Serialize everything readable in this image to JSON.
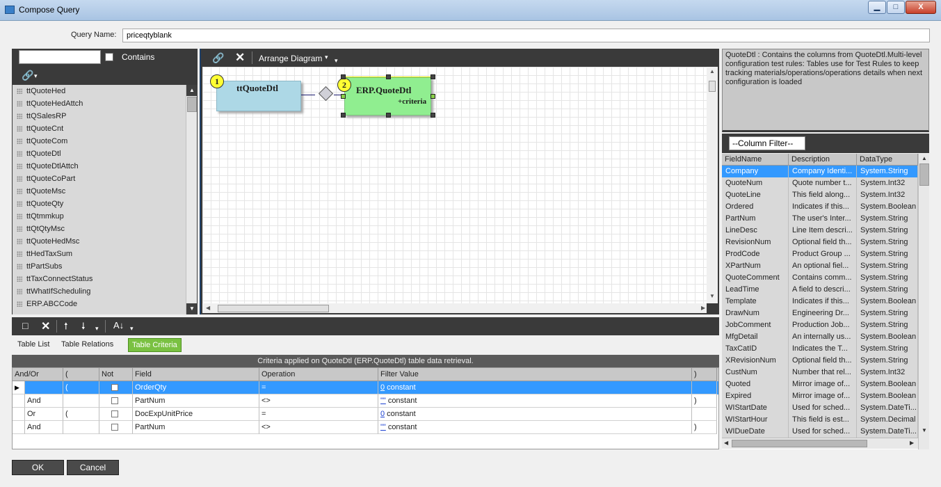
{
  "window": {
    "title": "Compose Query",
    "min_label": "▁",
    "max_label": "□",
    "close_label": "X"
  },
  "query": {
    "label": "Query Name:",
    "value": "priceqtyblank"
  },
  "table_search": {
    "value": "",
    "contains_label": "Contains"
  },
  "tables": [
    "ttQuoteHed",
    "ttQuoteHedAttch",
    "ttQSalesRP",
    "ttQuoteCnt",
    "ttQuoteCom",
    "ttQuoteDtl",
    "ttQuoteDtlAttch",
    "ttQuoteCoPart",
    "ttQuoteMsc",
    "ttQuoteQty",
    "ttQtmmkup",
    "ttQtQtyMsc",
    "ttQuoteHedMsc",
    "ttHedTaxSum",
    "ttPartSubs",
    "ttTaxConnectStatus",
    "ttWhatIfScheduling",
    "ERP.ABCCode"
  ],
  "diagram": {
    "arrange_label": "Arrange Diagram",
    "node1": {
      "badge": "1",
      "title": "ttQuoteDtl"
    },
    "node2": {
      "badge": "2",
      "title": "ERP.QuoteDtl",
      "subtitle": "+criteria"
    }
  },
  "description": "QuoteDtl : Contains the columns from QuoteDtl.Multi-level configuration test rules: Tables use for Test Rules to keep tracking materials/operations/operations details when next configuration is loaded",
  "column_filter": {
    "value": "--Column Filter--"
  },
  "columns_header": {
    "field": "FieldName",
    "desc": "Description",
    "type": "DataType"
  },
  "columns": [
    {
      "field": "Company",
      "desc": "Company Identi...",
      "type": "System.String"
    },
    {
      "field": "QuoteNum",
      "desc": "Quote number t...",
      "type": "System.Int32"
    },
    {
      "field": "QuoteLine",
      "desc": "This field along...",
      "type": "System.Int32"
    },
    {
      "field": "Ordered",
      "desc": "Indicates if this...",
      "type": "System.Boolean"
    },
    {
      "field": "PartNum",
      "desc": "The user's Inter...",
      "type": "System.String"
    },
    {
      "field": "LineDesc",
      "desc": "Line Item descri...",
      "type": "System.String"
    },
    {
      "field": "RevisionNum",
      "desc": "Optional field th...",
      "type": "System.String"
    },
    {
      "field": "ProdCode",
      "desc": "Product Group ...",
      "type": "System.String"
    },
    {
      "field": "XPartNum",
      "desc": "An optional fiel...",
      "type": "System.String"
    },
    {
      "field": "QuoteComment",
      "desc": "Contains comm...",
      "type": "System.String"
    },
    {
      "field": "LeadTime",
      "desc": "A field to descri...",
      "type": "System.String"
    },
    {
      "field": "Template",
      "desc": "Indicates if this...",
      "type": "System.Boolean"
    },
    {
      "field": "DrawNum",
      "desc": "Engineering Dr...",
      "type": "System.String"
    },
    {
      "field": "JobComment",
      "desc": "Production Job...",
      "type": "System.String"
    },
    {
      "field": "MfgDetail",
      "desc": "An internally us...",
      "type": "System.Boolean"
    },
    {
      "field": "TaxCatID",
      "desc": "Indicates the T...",
      "type": "System.String"
    },
    {
      "field": "XRevisionNum",
      "desc": "Optional field th...",
      "type": "System.String"
    },
    {
      "field": "CustNum",
      "desc": "Number that rel...",
      "type": "System.Int32"
    },
    {
      "field": "Quoted",
      "desc": "Mirror image of...",
      "type": "System.Boolean"
    },
    {
      "field": "Expired",
      "desc": "Mirror image of...",
      "type": "System.Boolean"
    },
    {
      "field": "WIStartDate",
      "desc": "Used for sched...",
      "type": "System.DateTi..."
    },
    {
      "field": "WIStartHour",
      "desc": "This field is est...",
      "type": "System.Decimal"
    },
    {
      "field": "WIDueDate",
      "desc": "Used for sched...",
      "type": "System.DateTi..."
    }
  ],
  "tabs": [
    "Table List",
    "Table Relations",
    "Table Criteria"
  ],
  "criteria": {
    "caption": "Criteria applied on QuoteDtl (ERP.QuoteDtl)  table data retrieval.",
    "headers": [
      "And/Or",
      "(",
      "Not",
      "Field",
      "Operation",
      "Filter Value",
      ")"
    ],
    "rows": [
      {
        "andor": "",
        "paren_open": "(",
        "field": "OrderQty",
        "op": "=",
        "fv_num": "0",
        "fv_text": "constant",
        "paren_close": ""
      },
      {
        "andor": "And",
        "paren_open": "",
        "field": "PartNum",
        "op": "<>",
        "fv_num": "\"\"",
        "fv_text": "constant",
        "paren_close": ")"
      },
      {
        "andor": "Or",
        "paren_open": "(",
        "field": "DocExpUnitPrice",
        "op": "=",
        "fv_num": "0",
        "fv_text": "constant",
        "paren_close": ""
      },
      {
        "andor": "And",
        "paren_open": "",
        "field": "PartNum",
        "op": "<>",
        "fv_num": "\"\"",
        "fv_text": "constant",
        "paren_close": ")"
      }
    ]
  },
  "buttons": {
    "ok": "OK",
    "cancel": "Cancel"
  },
  "colors": {
    "selection": "#3399ff",
    "active_tab": "#7ac142",
    "node1": "#add8e6",
    "node2": "#90ee90",
    "toolbar": "#3a3a3a"
  }
}
